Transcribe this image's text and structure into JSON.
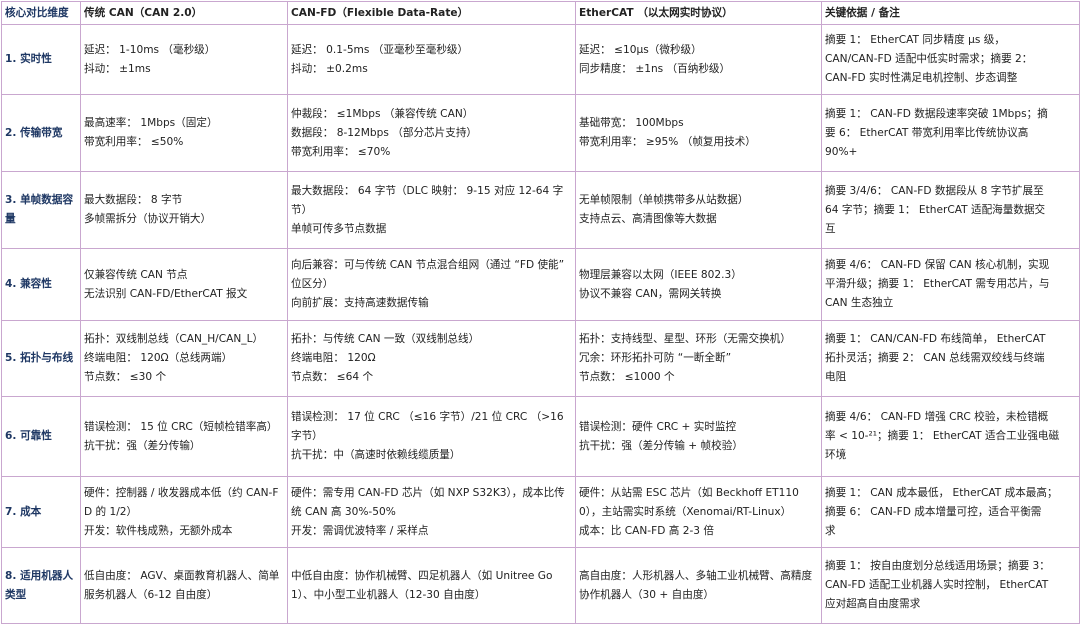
{
  "table": {
    "headers": [
      "核心对比维度",
      "传统 CAN（CAN 2.0）",
      "CAN-FD（Flexible Data-Rate）",
      "EtherCAT （以太网实时协议）",
      "关键依据 / 备注"
    ],
    "rows": [
      {
        "dim": "1. 实时性",
        "can": [
          "延迟： 1-10ms （毫秒级）",
          "抖动： ±1ms"
        ],
        "canfd": [
          "延迟： 0.1-5ms （亚毫秒至毫秒级）",
          "抖动： ±0.2ms"
        ],
        "ethercat": [
          "延迟： ≤10μs（微秒级）",
          "同步精度： ±1ns （百纳秒级）"
        ],
        "note": [
          "摘要 1： EtherCAT 同步精度 μs 级，",
          "CAN/CAN-FD 适配中低实时需求；摘要 2：",
          "CAN-FD 实时性满足电机控制、步态调整"
        ]
      },
      {
        "dim": "2. 传输带宽",
        "can": [
          "最高速率： 1Mbps（固定）",
          "带宽利用率： ≤50%"
        ],
        "canfd": [
          "仲裁段： ≤1Mbps （兼容传统 CAN）",
          "数据段： 8-12Mbps （部分芯片支持）",
          "带宽利用率： ≤70%"
        ],
        "ethercat": [
          "基础带宽： 100Mbps",
          "带宽利用率： ≥95% （帧复用技术）"
        ],
        "note": [
          "摘要 1： CAN-FD 数据段速率突破 1Mbps；摘",
          "要 6： EtherCAT 带宽利用率比传统协议高",
          "90%+"
        ]
      },
      {
        "dim": "3. 单帧数据容量",
        "can": [
          "最大数据段： 8 字节",
          "多帧需拆分（协议开销大）"
        ],
        "canfd": [
          "最大数据段： 64 字节（DLC 映射： 9-15 对应 12-64 字节）",
          "单帧可传多节点数据"
        ],
        "ethercat": [
          "无单帧限制（单帧携带多从站数据）",
          "支持点云、高清图像等大数据"
        ],
        "note": [
          "摘要 3/4/6： CAN-FD 数据段从 8 字节扩展至",
          "64 字节；摘要 1： EtherCAT 适配海量数据交",
          "互"
        ]
      },
      {
        "dim": "4. 兼容性",
        "can": [
          "仅兼容传统 CAN 节点",
          "无法识别 CAN-FD/EtherCAT 报文"
        ],
        "canfd": [
          "向后兼容：可与传统 CAN 节点混合组网（通过 “FD 使能” 位区分）",
          "向前扩展：支持高速数据传输"
        ],
        "ethercat": [
          "物理层兼容以太网（IEEE 802.3）",
          "协议不兼容 CAN，需网关转换"
        ],
        "note": [
          "摘要 4/6： CAN-FD 保留 CAN 核心机制，实现",
          "平滑升级；摘要 1： EtherCAT 需专用芯片，与",
          "CAN 生态独立"
        ]
      },
      {
        "dim": "5. 拓扑与布线",
        "can": [
          "拓扑：双线制总线（CAN_H/CAN_L）",
          "终端电阻： 120Ω（总线两端）",
          "节点数： ≤30 个"
        ],
        "canfd": [
          "拓扑：与传统 CAN 一致（双线制总线）",
          "终端电阻： 120Ω",
          "节点数： ≤64 个"
        ],
        "ethercat": [
          "拓扑：支持线型、星型、环形（无需交换机）",
          "冗余：环形拓扑可防 “一断全断”",
          "节点数： ≤1000 个"
        ],
        "note": [
          "摘要 1： CAN/CAN-FD 布线简单， EtherCAT",
          "拓扑灵活；摘要 2： CAN 总线需双绞线与终端",
          "电阻"
        ]
      },
      {
        "dim": "6. 可靠性",
        "can": [
          "错误检测： 15 位 CRC（短帧检错率高）",
          "抗干扰：强（差分传输）"
        ],
        "canfd": [
          "错误检测： 17 位 CRC （≤16 字节）/21 位 CRC （>16 字节）",
          "抗干扰：中（高速时依赖线缆质量）"
        ],
        "ethercat": [
          "错误检测：硬件 CRC + 实时监控",
          "抗干扰：强（差分传输 + 帧校验）"
        ],
        "note": [
          "摘要 4/6： CAN-FD 增强 CRC 校验，未检错概",
          "率 < 10-²¹；摘要 1： EtherCAT 适合工业强电磁",
          "环境"
        ]
      },
      {
        "dim": "7. 成本",
        "can": [
          "硬件：控制器 / 收发器成本低（约 CAN-FD 的 1/2）",
          "开发：软件栈成熟，无额外成本"
        ],
        "canfd": [
          "硬件：需专用 CAN-FD 芯片（如 NXP S32K3），成本比传统 CAN 高 30%-50%",
          "开发：需调优波特率 / 采样点"
        ],
        "ethercat": [
          "硬件：从站需 ESC 芯片（如 Beckhoff ET1100），主站需实时系统（Xenomai/RT-Linux）",
          "成本：比 CAN-FD 高 2-3 倍"
        ],
        "note": [
          "摘要 1： CAN 成本最低， EtherCAT 成本最高；",
          "摘要 6： CAN-FD 成本增量可控，适合平衡需",
          "求"
        ]
      },
      {
        "dim": "8. 适用机器人类型",
        "can": [
          "低自由度： AGV、桌面教育机器人、简单服务机器人（6-12 自由度）"
        ],
        "canfd": [
          "中低自由度：协作机械臂、四足机器人（如 Unitree Go1）、中小型工业机器人（12-30 自由度）"
        ],
        "ethercat": [
          "高自由度：人形机器人、多轴工业机械臂、高精度协作机器人（30 + 自由度）"
        ],
        "note": [
          "摘要 1： 按自由度划分总线适用场景；摘要 3：",
          "CAN-FD 适配工业机器人实时控制， EtherCAT",
          "应对超高自由度需求"
        ]
      }
    ]
  }
}
